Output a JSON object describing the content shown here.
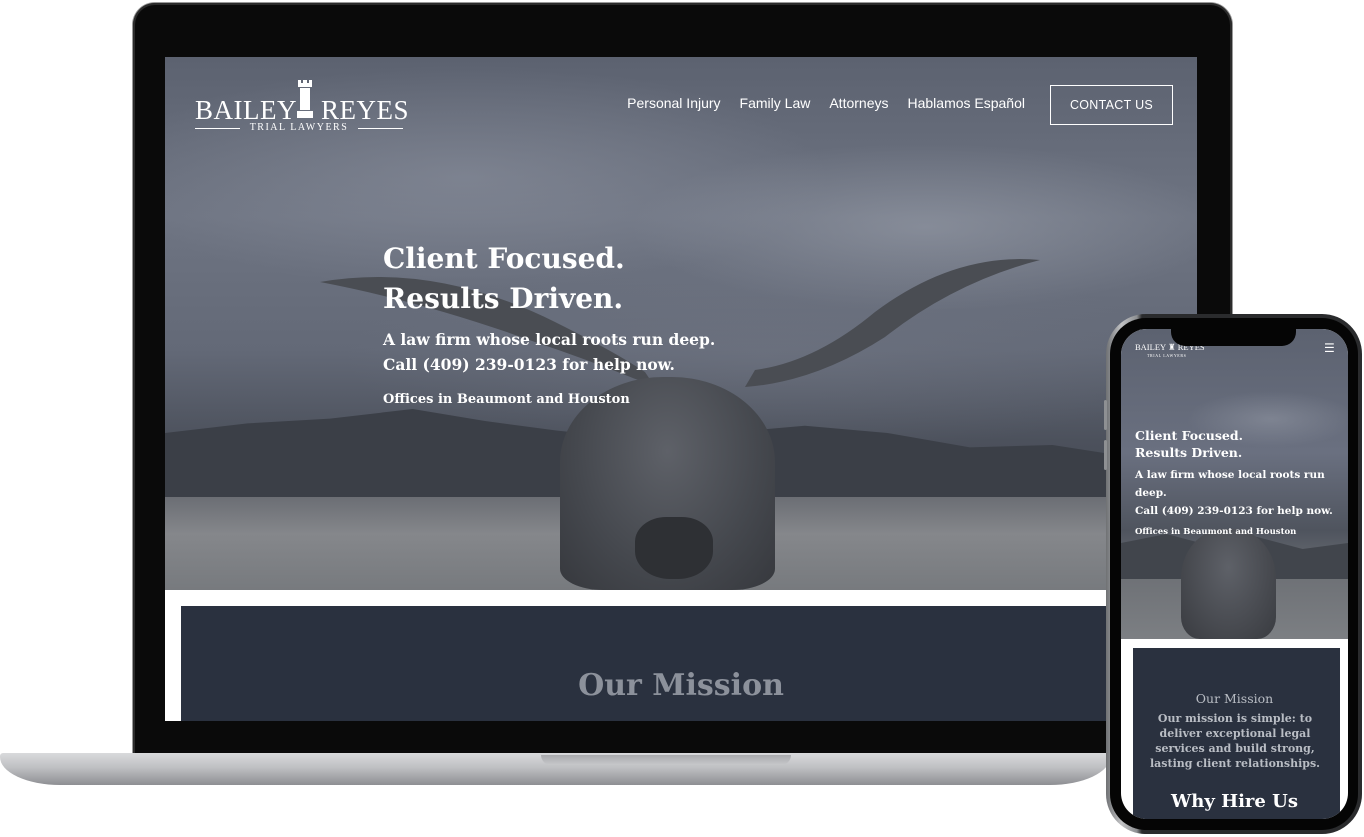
{
  "site": {
    "logo": {
      "name_left": "BAILEY",
      "name_right": "REYES",
      "tagline": "TRIAL LAWYERS"
    },
    "nav": [
      {
        "label": "Personal Injury"
      },
      {
        "label": "Family Law"
      },
      {
        "label": "Attorneys"
      },
      {
        "label": "Hablamos Español"
      }
    ],
    "contact_label": "CONTACT US",
    "hero": {
      "headline_1": "Client Focused.",
      "headline_2": "Results Driven.",
      "sub_1": "A law firm whose local roots run deep.",
      "sub_2": "Call (409) 239-0123 for help now.",
      "offices": "Offices in Beaumont and Houston"
    },
    "mission_title": "Our Mission"
  },
  "mobile": {
    "logo_name": "BAILEY ♜ REYES",
    "logo_tagline": "TRIAL LAWYERS",
    "menu_icon": "☰",
    "hero": {
      "headline_1": "Client Focused.",
      "headline_2": "Results Driven.",
      "sub_1": "A law firm whose local roots run deep.",
      "sub_2": "Call (409) 239-0123 for help now.",
      "offices": "Offices in Beaumont and Houston"
    },
    "mission_title": "Our Mission",
    "mission_text": "Our mission is simple: to deliver exceptional legal services and build strong, lasting client relationships.",
    "why_title": "Why Hire Us"
  },
  "colors": {
    "mission_panel": "#2a313f",
    "hero_overlay": "#5c6270"
  }
}
